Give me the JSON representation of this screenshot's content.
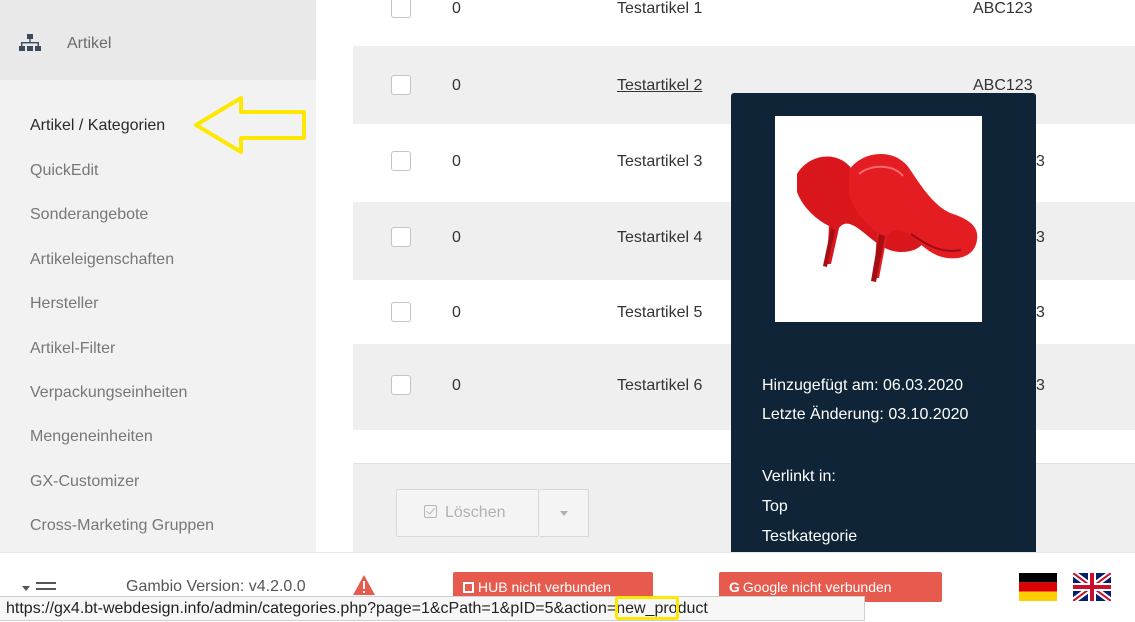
{
  "sidebar": {
    "header_label": "Artikel",
    "items": [
      {
        "label": "Artikel / Kategorien",
        "active": true
      },
      {
        "label": "QuickEdit"
      },
      {
        "label": "Sonderangebote"
      },
      {
        "label": "Artikeleigenschaften"
      },
      {
        "label": "Hersteller"
      },
      {
        "label": "Artikel-Filter"
      },
      {
        "label": "Verpackungseinheiten"
      },
      {
        "label": "Mengeneinheiten"
      },
      {
        "label": "GX-Customizer"
      },
      {
        "label": "Cross-Marketing Gruppen"
      }
    ]
  },
  "products": [
    {
      "qty": "0",
      "name": "Testartikel 1",
      "code": "ABC123"
    },
    {
      "qty": "0",
      "name": "Testartikel 2",
      "code": "ABC123"
    },
    {
      "qty": "0",
      "name": "Testartikel 3",
      "code": "3"
    },
    {
      "qty": "0",
      "name": "Testartikel 4",
      "code": "3"
    },
    {
      "qty": "0",
      "name": "Testartikel 5",
      "code": "3"
    },
    {
      "qty": "0",
      "name": "Testartikel 6",
      "code": "3"
    }
  ],
  "actions": {
    "delete_label": "Löschen"
  },
  "popover": {
    "added": "Hinzugefügt am: 06.03.2020",
    "modified": "Letzte Änderung: 03.10.2020",
    "linked_heading": "Verlinkt in:",
    "linked": [
      "Top",
      "Testkategorie"
    ]
  },
  "status": {
    "version": "Gambio Version: v4.2.0.0",
    "hub_badge": "HUB nicht verbunden",
    "google_badge": "Google nicht verbunden",
    "url": "https://gx4.bt-webdesign.info/admin/categories.php?page=1&cPath=1&pID=5&action=new_product"
  },
  "colors": {
    "sidebar_bg": "#f2f2f2",
    "popover_bg": "#0f2436",
    "badge_red": "#e75a4e",
    "highlight_yellow": "#ffe800"
  },
  "icons": [
    "sitemap-icon",
    "hamburger-menu-icon",
    "warning-icon",
    "share-icon",
    "google-icon",
    "flag-de-icon",
    "flag-uk-icon"
  ]
}
